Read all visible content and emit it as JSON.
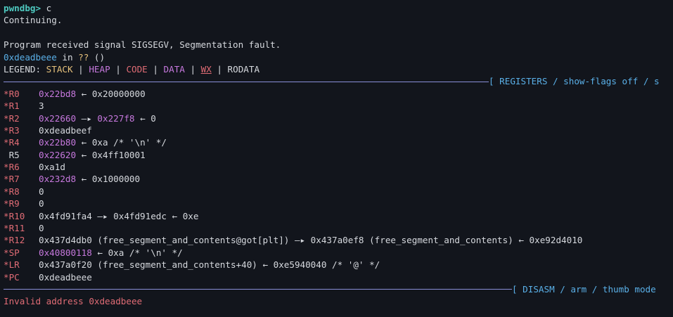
{
  "prompt": "pwndbg>",
  "command": "c",
  "continuing": "Continuing.",
  "signal_message": "Program received signal SIGSEGV, Segmentation fault.",
  "location": {
    "address": "0xdeadbeee",
    "in_text": " in ",
    "func": "??",
    "args": " ()"
  },
  "legend": {
    "label": "LEGEND: ",
    "stack": "STACK",
    "heap": "HEAP",
    "code": "CODE",
    "data": "DATA",
    "wx": "WX",
    "rodata": "RODATA",
    "sep": " | "
  },
  "registers_header": "[ REGISTERS / show-flags off / s",
  "registers": [
    {
      "name": "*R0",
      "parts": [
        {
          "t": "0x22bd8",
          "c": "heap"
        },
        {
          "t": " ← 0x20000000",
          "c": "plain"
        }
      ]
    },
    {
      "name": "*R1",
      "parts": [
        {
          "t": "3",
          "c": "plain"
        }
      ]
    },
    {
      "name": "*R2",
      "parts": [
        {
          "t": "0x22660",
          "c": "heap"
        },
        {
          "t": " —▸ ",
          "c": "plain"
        },
        {
          "t": "0x227f8",
          "c": "heap"
        },
        {
          "t": " ← 0",
          "c": "plain"
        }
      ]
    },
    {
      "name": "*R3",
      "parts": [
        {
          "t": "0xdeadbeef",
          "c": "plain"
        }
      ]
    },
    {
      "name": "*R4",
      "parts": [
        {
          "t": "0x22b80",
          "c": "heap"
        },
        {
          "t": " ← 0xa /* '\\n' */",
          "c": "plain"
        }
      ]
    },
    {
      "name": " R5",
      "plain": true,
      "parts": [
        {
          "t": "0x22620",
          "c": "heap"
        },
        {
          "t": " ← 0x4ff10001",
          "c": "plain"
        }
      ]
    },
    {
      "name": "*R6",
      "parts": [
        {
          "t": "0xa1d",
          "c": "plain"
        }
      ]
    },
    {
      "name": "*R7",
      "parts": [
        {
          "t": "0x232d8",
          "c": "heap"
        },
        {
          "t": " ← 0x1000000",
          "c": "plain"
        }
      ]
    },
    {
      "name": "*R8",
      "parts": [
        {
          "t": "0",
          "c": "plain"
        }
      ]
    },
    {
      "name": "*R9",
      "parts": [
        {
          "t": "0",
          "c": "plain"
        }
      ]
    },
    {
      "name": "*R10",
      "parts": [
        {
          "t": "0x4fd91fa4 —▸ 0x4fd91edc ← 0xe",
          "c": "plain"
        }
      ]
    },
    {
      "name": "*R11",
      "parts": [
        {
          "t": "0",
          "c": "plain"
        }
      ]
    },
    {
      "name": "*R12",
      "parts": [
        {
          "t": "0x437d4db0 (free_segment_and_contents@got[plt]) —▸ 0x437a0ef8 (free_segment_and_contents) ← 0xe92d4010",
          "c": "plain"
        }
      ]
    },
    {
      "name": "*SP",
      "parts": [
        {
          "t": "0x40800118",
          "c": "heap"
        },
        {
          "t": " ← 0xa /* '\\n' */",
          "c": "plain"
        }
      ]
    },
    {
      "name": "*LR",
      "parts": [
        {
          "t": "0x437a0f20 (free_segment_and_contents+40) ← 0xe5940040 /* '@' */",
          "c": "plain"
        }
      ]
    },
    {
      "name": "*PC",
      "parts": [
        {
          "t": "0xdeadbeee",
          "c": "plain"
        }
      ]
    }
  ],
  "disasm_header": "[ DISASM / arm / thumb mode",
  "disasm_error": "Invalid address 0xdeadbeee"
}
